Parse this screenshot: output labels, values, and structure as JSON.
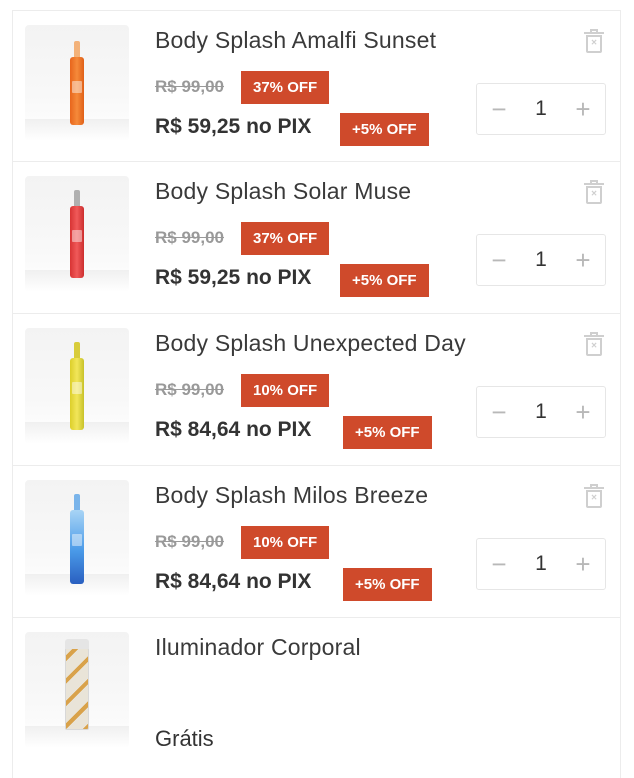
{
  "cart": {
    "items": [
      {
        "name": "Body Splash Amalfi Sunset",
        "old_price": "R$ 99,00",
        "discount": "37% OFF",
        "pix_price": "R$ 59,25 no PIX",
        "pix_discount": "+5% OFF",
        "quantity": "1",
        "product_color": "#f07a2a"
      },
      {
        "name": "Body Splash Solar Muse",
        "old_price": "R$ 99,00",
        "discount": "37% OFF",
        "pix_price": "R$ 59,25 no PIX",
        "pix_discount": "+5% OFF",
        "quantity": "1",
        "product_color": "#e84a4a"
      },
      {
        "name": "Body Splash Unexpected Day",
        "old_price": "R$ 99,00",
        "discount": "10% OFF",
        "pix_price": "R$ 84,64 no PIX",
        "pix_discount": "+5% OFF",
        "quantity": "1",
        "product_color": "#e8d84a"
      },
      {
        "name": "Body Splash Milos Breeze",
        "old_price": "R$ 99,00",
        "discount": "10% OFF",
        "pix_price": "R$ 84,64 no PIX",
        "pix_discount": "+5% OFF",
        "quantity": "1",
        "product_color": "#4a9ae8"
      }
    ],
    "gift": {
      "name": "Iluminador Corporal",
      "price_label": "Grátis"
    },
    "controls": {
      "minus_symbol": "−",
      "plus_symbol": "+",
      "remove_symbol": "×"
    },
    "colors": {
      "badge": "#cf4a2b",
      "text": "#333333",
      "muted": "#999999"
    }
  }
}
